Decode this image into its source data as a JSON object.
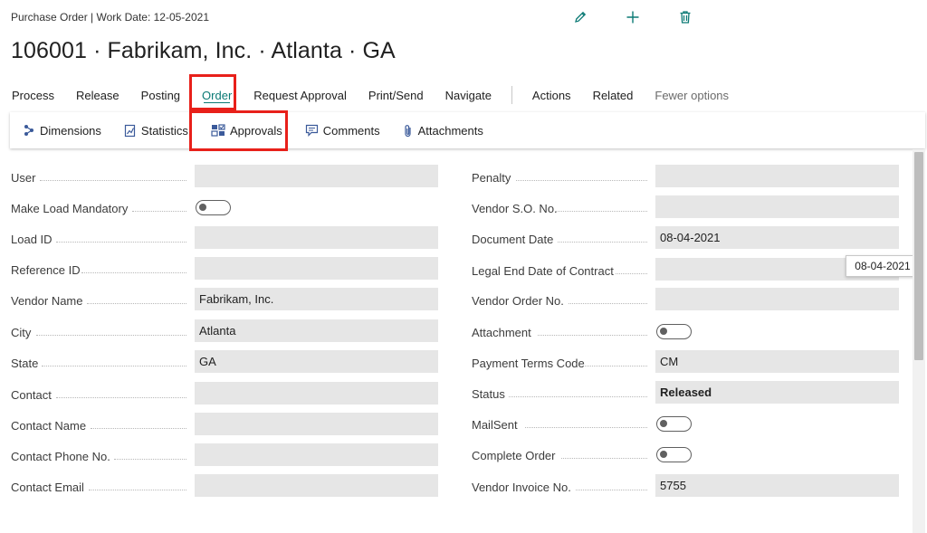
{
  "header": {
    "breadcrumb": "Purchase Order | Work Date: 12-05-2021",
    "title": "106001 · Fabrikam, Inc. · Atlanta · GA",
    "actions": [
      {
        "name": "edit-pencil-icon"
      },
      {
        "name": "add-plus-icon"
      },
      {
        "name": "delete-trash-icon"
      }
    ]
  },
  "menu": {
    "items": [
      "Process",
      "Release",
      "Posting",
      "Order",
      "Request Approval",
      "Print/Send",
      "Navigate"
    ],
    "secondary": [
      "Actions",
      "Related"
    ],
    "fewer": "Fewer options",
    "active": "Order"
  },
  "submenu": {
    "items": [
      {
        "label": "Dimensions",
        "icon": "dimensions-icon"
      },
      {
        "label": "Statistics",
        "icon": "statistics-icon"
      },
      {
        "label": "Approvals",
        "icon": "approvals-icon"
      },
      {
        "label": "Comments",
        "icon": "comments-icon"
      },
      {
        "label": "Attachments",
        "icon": "paperclip-icon"
      }
    ]
  },
  "fields_left": [
    {
      "label": "User",
      "type": "text",
      "value": ""
    },
    {
      "label": "Make Load Mandatory",
      "type": "toggle",
      "value": "off"
    },
    {
      "label": "Load ID",
      "type": "text",
      "value": ""
    },
    {
      "label": "Reference ID",
      "type": "text",
      "value": ""
    },
    {
      "label": "Vendor Name",
      "type": "text",
      "value": "Fabrikam, Inc."
    },
    {
      "label": "City",
      "type": "text",
      "value": "Atlanta"
    },
    {
      "label": "State",
      "type": "text",
      "value": "GA"
    },
    {
      "label": "Contact",
      "type": "text",
      "value": ""
    },
    {
      "label": "Contact Name",
      "type": "text",
      "value": ""
    },
    {
      "label": "Contact Phone No.",
      "type": "text",
      "value": ""
    },
    {
      "label": "Contact Email",
      "type": "text",
      "value": ""
    }
  ],
  "fields_right": [
    {
      "label": "Penalty",
      "type": "text",
      "value": ""
    },
    {
      "label": "Vendor S.O. No.",
      "type": "text",
      "value": ""
    },
    {
      "label": "Document Date",
      "type": "text",
      "value": "08-04-2021"
    },
    {
      "label": "Legal End Date of Contract",
      "type": "text",
      "value": ""
    },
    {
      "label": "Vendor Order No.",
      "type": "text",
      "value": ""
    },
    {
      "label": "Attachment",
      "type": "toggle",
      "value": "off"
    },
    {
      "label": "Payment Terms Code",
      "type": "text",
      "value": "CM"
    },
    {
      "label": "Status",
      "type": "text",
      "value": "Released",
      "bold": true
    },
    {
      "label": "MailSent",
      "type": "toggle",
      "value": "off"
    },
    {
      "label": "Complete Order",
      "type": "toggle",
      "value": "off"
    },
    {
      "label": "Vendor Invoice No.",
      "type": "text",
      "value": "5755"
    }
  ],
  "tooltip": "08-04-2021",
  "colors": {
    "accent": "#0b7a75",
    "highlight": "#e8201a",
    "field_bg": "#e6e6e6"
  }
}
